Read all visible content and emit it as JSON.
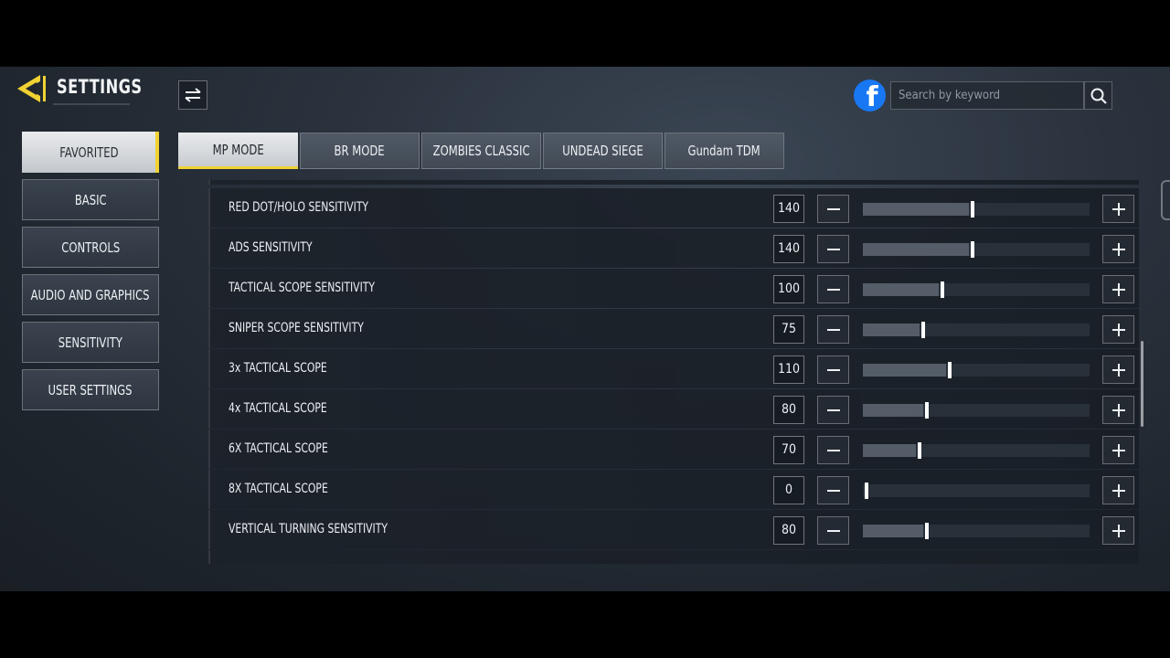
{
  "header": {
    "title": "SETTINGS",
    "search_placeholder": "Search by keyword",
    "facebook_glyph": "f"
  },
  "colors": {
    "accent": "#f0d233",
    "facebook": "#1877f2"
  },
  "icons": {
    "back": "back-arrow-icon",
    "filter": "swap-arrows-icon",
    "facebook": "facebook-icon",
    "search": "search-icon",
    "minus": "minus-icon",
    "plus": "plus-icon"
  },
  "sidebar": {
    "items": [
      {
        "label": "FAVORITED",
        "active": true
      },
      {
        "label": "BASIC"
      },
      {
        "label": "CONTROLS"
      },
      {
        "label": "AUDIO AND GRAPHICS"
      },
      {
        "label": "SENSITIVITY"
      },
      {
        "label": "USER SETTINGS"
      }
    ]
  },
  "tabs": [
    {
      "label": "MP MODE",
      "active": true
    },
    {
      "label": "BR MODE"
    },
    {
      "label": "ZOMBIES CLASSIC"
    },
    {
      "label": "UNDEAD SIEGE"
    },
    {
      "label": "Gundam TDM"
    }
  ],
  "settings": {
    "max": 300,
    "rows": [
      {
        "label": "RED DOT/HOLO SENSITIVITY",
        "value": "140"
      },
      {
        "label": "ADS SENSITIVITY",
        "value": "140"
      },
      {
        "label": "TACTICAL SCOPE SENSITIVITY",
        "value": "100"
      },
      {
        "label": "SNIPER SCOPE SENSITIVITY",
        "value": "75"
      },
      {
        "label": "3x TACTICAL SCOPE",
        "value": "110"
      },
      {
        "label": "4x TACTICAL SCOPE",
        "value": "80"
      },
      {
        "label": "6X TACTICAL SCOPE",
        "value": "70"
      },
      {
        "label": "8X TACTICAL SCOPE",
        "value": "0"
      },
      {
        "label": "VERTICAL TURNING SENSITIVITY",
        "value": "80"
      }
    ]
  }
}
